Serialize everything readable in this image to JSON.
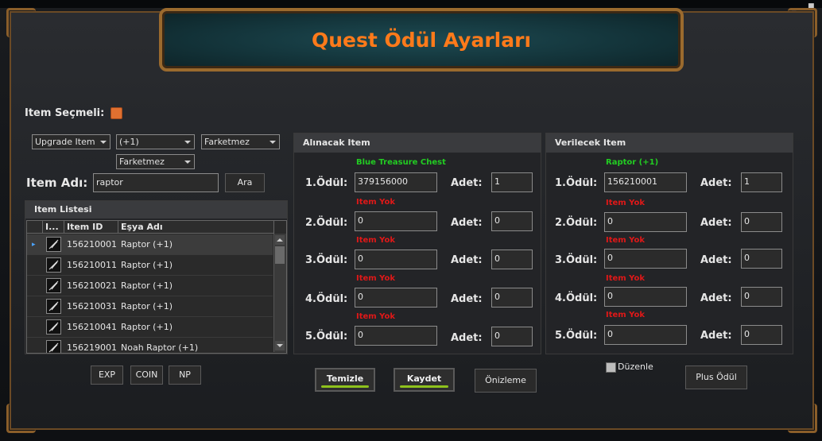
{
  "window": {
    "title": "Quest Ödül Ayarları",
    "minimize_glyph": "_",
    "close_glyph": "■"
  },
  "selection": {
    "item_secmeli_label": "Item Seçmeli:",
    "dropdowns": {
      "category": "Upgrade Item",
      "grade": "(+1)",
      "type1": "Farketmez",
      "type2": "Farketmez"
    },
    "item_name_label": "Item Adı:",
    "search_value": "raptor",
    "search_button": "Ara"
  },
  "item_list": {
    "title": "Item Listesi",
    "columns": [
      "I...",
      "Item ID",
      "Eşya Adı"
    ],
    "rows": [
      {
        "id": "156210001",
        "name": "Raptor (+1)"
      },
      {
        "id": "156210011",
        "name": "Raptor (+1)"
      },
      {
        "id": "156210021",
        "name": "Raptor (+1)"
      },
      {
        "id": "156210031",
        "name": "Raptor (+1)"
      },
      {
        "id": "156210041",
        "name": "Raptor (+1)"
      },
      {
        "id": "156219001",
        "name": "Noah Raptor (+1)"
      }
    ],
    "selected_indicator": "▸"
  },
  "currency_buttons": {
    "exp": "EXP",
    "coin": "COIN",
    "np": "NP"
  },
  "alinacak": {
    "title": "Alınacak Item",
    "rewards": [
      {
        "label": "1.Ödül:",
        "status": "Blue Treasure Chest",
        "status_type": "green",
        "value": "379156000",
        "adet_label": "Adet:",
        "adet": "1"
      },
      {
        "label": "2.Ödül:",
        "status": "Item Yok",
        "status_type": "red",
        "value": "0",
        "adet_label": "Adet:",
        "adet": "0"
      },
      {
        "label": "3.Ödül:",
        "status": "Item Yok",
        "status_type": "red",
        "value": "0",
        "adet_label": "Adet:",
        "adet": "0"
      },
      {
        "label": "4.Ödül:",
        "status": "Item Yok",
        "status_type": "red",
        "value": "0",
        "adet_label": "Adet:",
        "adet": "0"
      },
      {
        "label": "5.Ödül:",
        "status": "Item Yok",
        "status_type": "red",
        "value": "0",
        "adet_label": "Adet:",
        "adet": "0"
      }
    ]
  },
  "verilecek": {
    "title": "Verilecek Item",
    "rewards": [
      {
        "label": "1.Ödül:",
        "status": "Raptor (+1)",
        "status_type": "green",
        "value": "156210001",
        "adet_label": "Adet:",
        "adet": "1"
      },
      {
        "label": "2.Ödül:",
        "status": "Item Yok",
        "status_type": "red",
        "value": "0",
        "adet_label": "Adet:",
        "adet": "0"
      },
      {
        "label": "3.Ödül:",
        "status": "Item Yok",
        "status_type": "red",
        "value": "0",
        "adet_label": "Adet:",
        "adet": "0"
      },
      {
        "label": "4.Ödül:",
        "status": "Item Yok",
        "status_type": "red",
        "value": "0",
        "adet_label": "Adet:",
        "adet": "0"
      },
      {
        "label": "5.Ödül:",
        "status": "Item Yok",
        "status_type": "red",
        "value": "0",
        "adet_label": "Adet:",
        "adet": "0"
      }
    ]
  },
  "actions": {
    "temizle": "Temizle",
    "kaydet": "Kaydet",
    "onizleme": "Önizleme",
    "duzenle": "Düzenle",
    "plus_odul": "Plus Ödül"
  },
  "colors": {
    "accent": "#ff7a1a",
    "ok": "#22cc22",
    "error": "#e01818",
    "frame": "#9a6a2e"
  }
}
